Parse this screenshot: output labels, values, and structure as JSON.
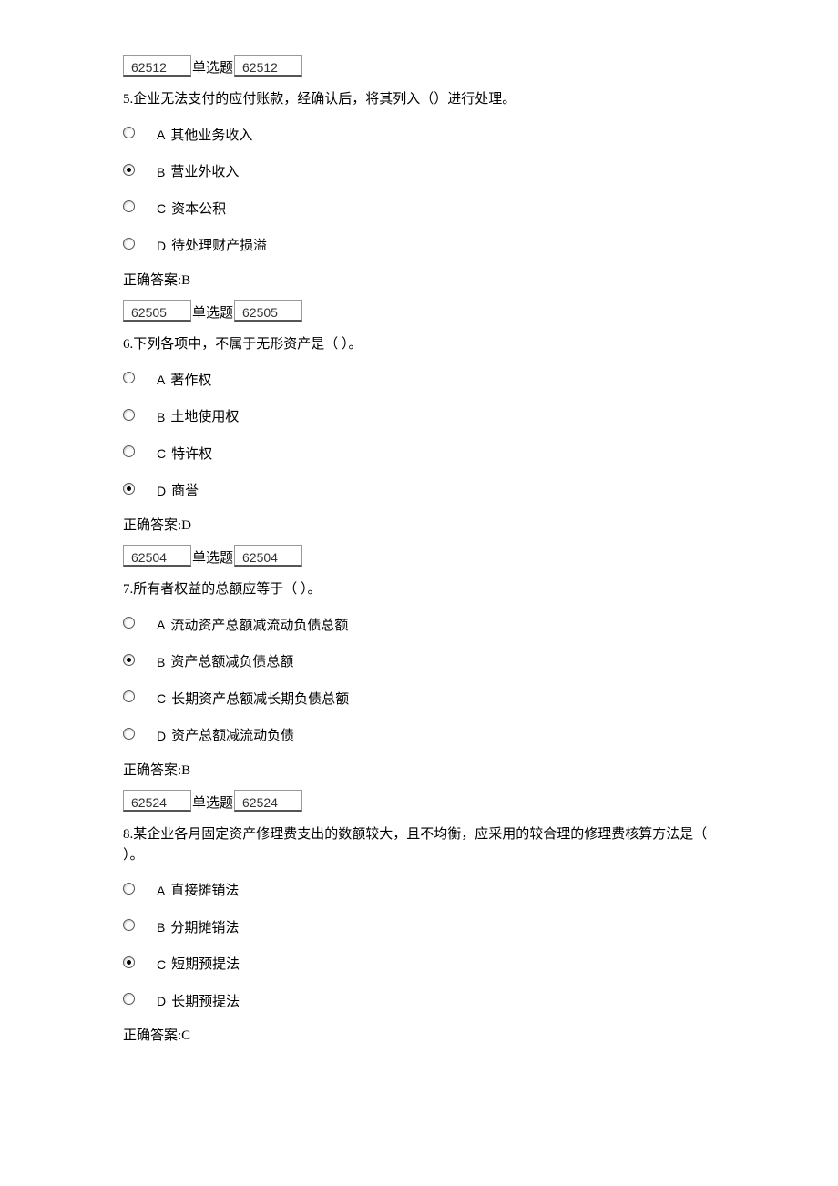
{
  "questions": [
    {
      "id1": "62512",
      "type_label": "单选题",
      "id2": "62512",
      "number": "5.",
      "text": "企业无法支付的应付账款，经确认后，将其列入（）进行处理。",
      "options": [
        {
          "letter": "A",
          "text": "其他业务收入",
          "selected": false
        },
        {
          "letter": "B",
          "text": "营业外收入",
          "selected": true
        },
        {
          "letter": "C",
          "text": "资本公积",
          "selected": false
        },
        {
          "letter": "D",
          "text": "待处理财产损溢",
          "selected": false
        }
      ],
      "answer_label": "正确答案:",
      "answer": "B"
    },
    {
      "id1": "62505",
      "type_label": "单选题",
      "id2": "62505",
      "number": "6.",
      "text": "下列各项中，不属于无形资产是（ ）。",
      "options": [
        {
          "letter": "A",
          "text": "著作权",
          "selected": false
        },
        {
          "letter": "B",
          "text": "土地使用权",
          "selected": false
        },
        {
          "letter": "C",
          "text": "特许权",
          "selected": false
        },
        {
          "letter": "D",
          "text": "商誉",
          "selected": true
        }
      ],
      "answer_label": "正确答案:",
      "answer": "D"
    },
    {
      "id1": "62504",
      "type_label": "单选题",
      "id2": "62504",
      "number": "7.",
      "text": "所有者权益的总额应等于（ ）。",
      "options": [
        {
          "letter": "A",
          "text": "流动资产总额减流动负债总额",
          "selected": false
        },
        {
          "letter": "B",
          "text": "资产总额减负债总额",
          "selected": true
        },
        {
          "letter": "C",
          "text": "长期资产总额减长期负债总额",
          "selected": false
        },
        {
          "letter": "D",
          "text": "资产总额减流动负债",
          "selected": false
        }
      ],
      "answer_label": "正确答案:",
      "answer": "B"
    },
    {
      "id1": "62524",
      "type_label": "单选题",
      "id2": "62524",
      "number": "8.",
      "text": "某企业各月固定资产修理费支出的数额较大，且不均衡，应采用的较合理的修理费核算方法是（ ）。",
      "options": [
        {
          "letter": "A",
          "text": "直接摊销法",
          "selected": false
        },
        {
          "letter": "B",
          "text": "分期摊销法",
          "selected": false
        },
        {
          "letter": "C",
          "text": "短期预提法",
          "selected": true
        },
        {
          "letter": "D",
          "text": "长期预提法",
          "selected": false
        }
      ],
      "answer_label": "正确答案:",
      "answer": "C"
    }
  ]
}
